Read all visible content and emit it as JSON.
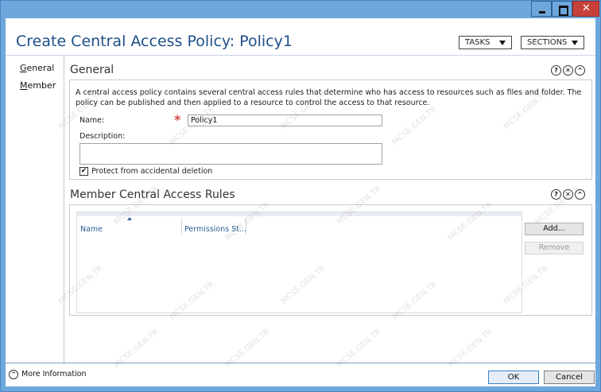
{
  "window": {
    "title": "Create Central Access Policy: Policy1"
  },
  "header": {
    "tasks_label": "TASKS",
    "sections_label": "SECTIONS"
  },
  "nav": {
    "items": [
      {
        "label": "General"
      },
      {
        "label": "Member"
      }
    ]
  },
  "general": {
    "title": "General",
    "description": "A central access policy contains several central access rules that determine who has access to resources such as files and folder. The policy can be published and then applied to a resource to control the access to that resource.",
    "name_label": "Name:",
    "name_value": "Policy1",
    "description_label": "Description:",
    "description_value": "",
    "protect_label": "Protect from accidental deletion",
    "protect_checked": true
  },
  "member": {
    "title": "Member Central Access Rules",
    "columns": [
      "Name",
      "Permissions St..."
    ],
    "rows": [],
    "add_label": "Add...",
    "remove_label": "Remove"
  },
  "section_icons": {
    "help": "?",
    "close": "✕",
    "collapse": "^"
  },
  "footer": {
    "more_info_label": "More Information",
    "ok_label": "OK",
    "cancel_label": "Cancel"
  },
  "watermark": "MCSE.GEN.TR",
  "colors": {
    "title_text": "#1e4f8a",
    "window_frame": "#6ea7dc",
    "close_button": "#c7413a",
    "required_star": "#d24c46",
    "column_header": "#2d5f96"
  }
}
